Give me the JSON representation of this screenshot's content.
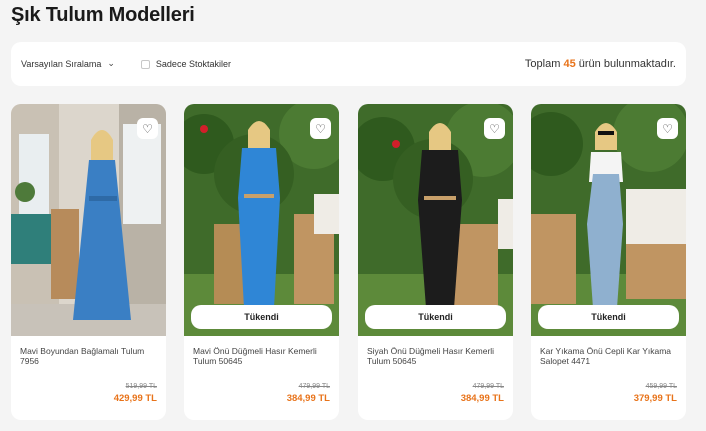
{
  "page": {
    "title": "Şık Tulum Modelleri"
  },
  "toolbar": {
    "sort_label": "Varsayılan Sıralama",
    "stock_filter_label": "Sadece Stoktakiler",
    "total_prefix": "Toplam",
    "total_count": "45",
    "total_suffix": "ürün bulunmaktadır."
  },
  "products": [
    {
      "name": "Mavi Boyundan Bağlamalı Tulum 7956",
      "old_price": "519,99 TL",
      "price": "429,99 TL",
      "sold_out": false,
      "sold_out_label": "",
      "garment_color": "#3a7fc4"
    },
    {
      "name": "Mavi Önü Düğmeli Hasır Kemerli Tulum 50645",
      "old_price": "479,99 TL",
      "price": "384,99 TL",
      "sold_out": true,
      "sold_out_label": "Tükendi",
      "garment_color": "#2f86d6"
    },
    {
      "name": "Siyah Önü Düğmeli Hasır Kemerli Tulum 50645",
      "old_price": "479,99 TL",
      "price": "384,99 TL",
      "sold_out": true,
      "sold_out_label": "Tükendi",
      "garment_color": "#1c1c1c"
    },
    {
      "name": "Kar Yıkama Önü Cepli Kar Yıkama Salopet 4471",
      "old_price": "459,99 TL",
      "price": "379,99 TL",
      "sold_out": true,
      "sold_out_label": "Tükendi",
      "garment_color": "#8fb0cf"
    }
  ],
  "colors": {
    "accent": "#e8731a",
    "background": "#f4f4f4"
  },
  "icons": {
    "favorite": "heart-icon",
    "sort": "chevron-down-icon"
  }
}
